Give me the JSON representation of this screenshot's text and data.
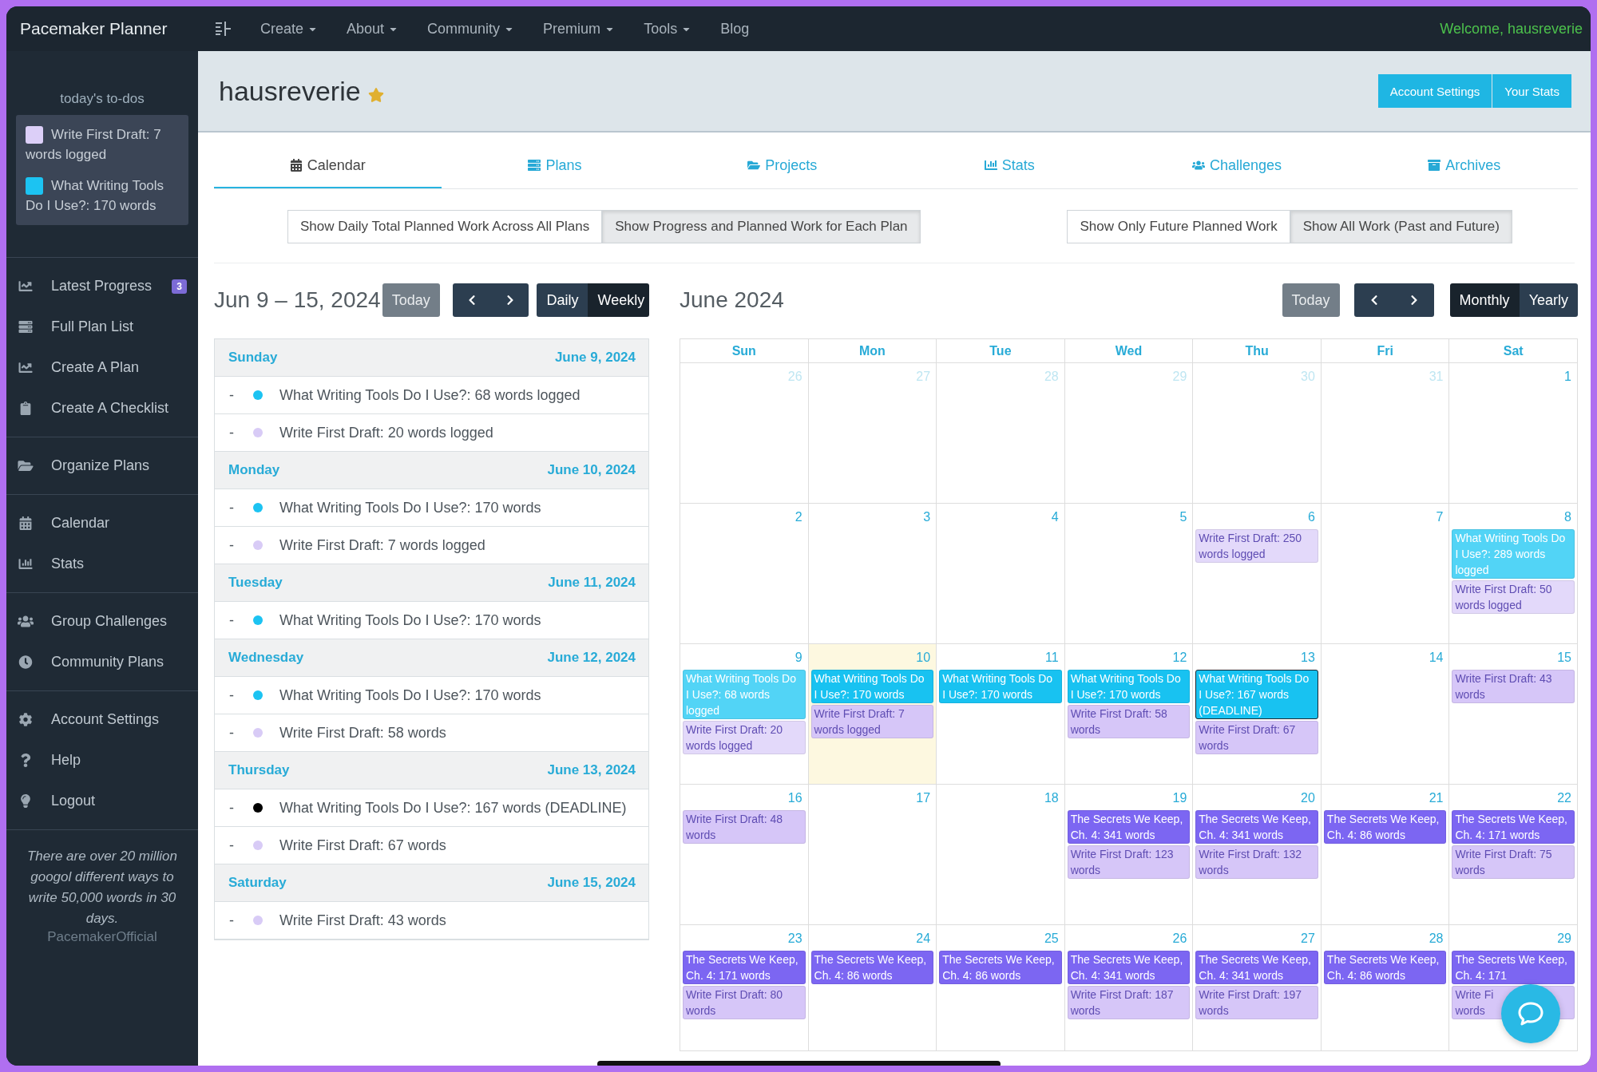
{
  "nav": {
    "brand": "Pacemaker Planner",
    "menus": [
      {
        "label": "Create",
        "dropdown": true
      },
      {
        "label": "About",
        "dropdown": true
      },
      {
        "label": "Community",
        "dropdown": true
      },
      {
        "label": "Premium",
        "dropdown": true
      },
      {
        "label": "Tools",
        "dropdown": true
      },
      {
        "label": "Blog",
        "dropdown": false
      }
    ],
    "welcome": "Welcome, hausreverie"
  },
  "sidebar": {
    "todo_title": "today's to-dos",
    "todos": [
      {
        "text": "Write First Draft: 7 words logged",
        "color": "#dccff8"
      },
      {
        "text": "What Writing Tools Do I Use?: 170 words",
        "color": "#1cc3f2"
      }
    ],
    "groups": [
      [
        {
          "label": "Latest Progress",
          "badge": "3"
        },
        {
          "label": "Full Plan List"
        },
        {
          "label": "Create A Plan"
        },
        {
          "label": "Create A Checklist"
        }
      ],
      [
        {
          "label": "Organize Plans"
        }
      ],
      [
        {
          "label": "Calendar"
        },
        {
          "label": "Stats"
        }
      ],
      [
        {
          "label": "Group Challenges"
        },
        {
          "label": "Community Plans"
        }
      ],
      [
        {
          "label": "Account Settings"
        },
        {
          "label": "Help"
        },
        {
          "label": "Logout"
        }
      ]
    ],
    "quote": "There are over 20 million googol different ways to write 50,000 words in 30 days.",
    "quote_author": "PacemakerOfficial"
  },
  "header": {
    "username": "hausreverie",
    "starred": true,
    "buttons": [
      "Account Settings",
      "Your Stats"
    ]
  },
  "tabs": [
    {
      "label": "Calendar",
      "selected": true
    },
    {
      "label": "Plans",
      "selected": false
    },
    {
      "label": "Projects",
      "selected": false
    },
    {
      "label": "Stats",
      "selected": false
    },
    {
      "label": "Challenges",
      "selected": false
    },
    {
      "label": "Archives",
      "selected": false
    }
  ],
  "toggles": {
    "left": [
      {
        "label": "Show Daily Total Planned Work Across All Plans",
        "selected": false
      },
      {
        "label": "Show Progress and Planned Work for Each Plan",
        "selected": true
      }
    ],
    "right": [
      {
        "label": "Show Only Future Planned Work",
        "selected": false
      },
      {
        "label": "Show All Work (Past and Future)",
        "selected": true
      }
    ]
  },
  "week": {
    "title": "Jun 9 – 15, 2024",
    "today": "Today",
    "views": [
      {
        "label": "Daily",
        "selected": false
      },
      {
        "label": "Weekly",
        "selected": true
      }
    ],
    "days": [
      {
        "day": "Sunday",
        "date": "June 9, 2024",
        "entries": [
          {
            "dash": "-",
            "text": "What Writing Tools Do I Use?: 68 words logged",
            "color": "#1cc3f2"
          },
          {
            "dash": "-",
            "text": "Write First Draft: 20 words logged",
            "color": "#d8cbf6"
          }
        ]
      },
      {
        "day": "Monday",
        "date": "June 10, 2024",
        "entries": [
          {
            "dash": "-",
            "text": "What Writing Tools Do I Use?: 170 words",
            "color": "#1cc3f2"
          },
          {
            "dash": "-",
            "text": "Write First Draft: 7 words logged",
            "color": "#d8cbf6"
          }
        ]
      },
      {
        "day": "Tuesday",
        "date": "June 11, 2024",
        "entries": [
          {
            "dash": "-",
            "text": "What Writing Tools Do I Use?: 170 words",
            "color": "#1cc3f2"
          }
        ]
      },
      {
        "day": "Wednesday",
        "date": "June 12, 2024",
        "entries": [
          {
            "dash": "-",
            "text": "What Writing Tools Do I Use?: 170 words",
            "color": "#1cc3f2"
          },
          {
            "dash": "-",
            "text": "Write First Draft: 58 words",
            "color": "#d8cbf6"
          }
        ]
      },
      {
        "day": "Thursday",
        "date": "June 13, 2024",
        "entries": [
          {
            "dash": "-",
            "text": "What Writing Tools Do I Use?: 167 words (DEADLINE)",
            "color": "#000000"
          },
          {
            "dash": "-",
            "text": "Write First Draft: 67 words",
            "color": "#d8cbf6"
          }
        ]
      },
      {
        "day": "Saturday",
        "date": "June 15, 2024",
        "entries": [
          {
            "dash": "-",
            "text": "Write First Draft: 43 words",
            "color": "#d8cbf6"
          }
        ]
      }
    ]
  },
  "month": {
    "title": "June 2024",
    "today": "Today",
    "views": [
      {
        "label": "Monthly",
        "selected": true
      },
      {
        "label": "Yearly",
        "selected": false
      }
    ],
    "weekdays": [
      "Sun",
      "Mon",
      "Tue",
      "Wed",
      "Thu",
      "Fri",
      "Sat"
    ],
    "weeks": [
      [
        {
          "n": "26",
          "outside": true,
          "today": false
        },
        {
          "n": "27",
          "outside": true,
          "today": false
        },
        {
          "n": "28",
          "outside": true,
          "today": false
        },
        {
          "n": "29",
          "outside": true,
          "today": false
        },
        {
          "n": "30",
          "outside": true,
          "today": false
        },
        {
          "n": "31",
          "outside": true,
          "today": false
        },
        {
          "n": "1",
          "outside": false,
          "today": false
        }
      ],
      [
        {
          "n": "2",
          "outside": false,
          "today": false
        },
        {
          "n": "3",
          "outside": false,
          "today": false
        },
        {
          "n": "4",
          "outside": false,
          "today": false
        },
        {
          "n": "5",
          "outside": false,
          "today": false
        },
        {
          "n": "6",
          "outside": false,
          "today": false,
          "events": [
            {
              "text": "Write First Draft: 250 words logged",
              "color": "#e3d9fa",
              "deadline": false
            }
          ]
        },
        {
          "n": "7",
          "outside": false,
          "today": false
        },
        {
          "n": "8",
          "outside": false,
          "today": false,
          "events": [
            {
              "text": "What Writing Tools Do I Use?: 289 words logged",
              "color": "#52d4f6",
              "deadline": false
            },
            {
              "text": "Write First Draft: 50 words logged",
              "color": "#e3d9fa",
              "deadline": false
            }
          ]
        }
      ],
      [
        {
          "n": "9",
          "outside": false,
          "today": false,
          "events": [
            {
              "text": "What Writing Tools Do I Use?: 68 words logged",
              "color": "#52d4f6",
              "deadline": false
            },
            {
              "text": "Write First Draft: 20 words logged",
              "color": "#e3d9fa",
              "deadline": false
            }
          ]
        },
        {
          "n": "10",
          "outside": false,
          "today": true,
          "events": [
            {
              "text": "What Writing Tools Do I Use?: 170 words",
              "color": "#18c2f1",
              "deadline": false
            },
            {
              "text": "Write First Draft: 7 words logged",
              "color": "#d6c6f8",
              "deadline": false
            }
          ]
        },
        {
          "n": "11",
          "outside": false,
          "today": false,
          "events": [
            {
              "text": "What Writing Tools Do I Use?: 170 words",
              "color": "#18c2f1",
              "deadline": false
            }
          ]
        },
        {
          "n": "12",
          "outside": false,
          "today": false,
          "events": [
            {
              "text": "What Writing Tools Do I Use?: 170 words",
              "color": "#18c2f1",
              "deadline": false
            },
            {
              "text": "Write First Draft: 58 words",
              "color": "#d6c6f8",
              "deadline": false
            }
          ]
        },
        {
          "n": "13",
          "outside": false,
          "today": false,
          "events": [
            {
              "text": "What Writing Tools Do I Use?: 167 words (DEADLINE)",
              "color": "#18c2f1",
              "deadline": true
            },
            {
              "text": "Write First Draft: 67 words",
              "color": "#d6c6f8",
              "deadline": false
            }
          ]
        },
        {
          "n": "14",
          "outside": false,
          "today": false
        },
        {
          "n": "15",
          "outside": false,
          "today": false,
          "events": [
            {
              "text": "Write First Draft: 43 words",
              "color": "#d6c6f8",
              "deadline": false
            }
          ]
        }
      ],
      [
        {
          "n": "16",
          "outside": false,
          "today": false,
          "events": [
            {
              "text": "Write First Draft: 48 words",
              "color": "#d6c6f8",
              "deadline": false
            }
          ]
        },
        {
          "n": "17",
          "outside": false,
          "today": false
        },
        {
          "n": "18",
          "outside": false,
          "today": false
        },
        {
          "n": "19",
          "outside": false,
          "today": false,
          "events": [
            {
              "text": "The Secrets We Keep, Ch. 4: 341 words",
              "color": "#7c66f2",
              "deadline": false
            },
            {
              "text": "Write First Draft: 123 words",
              "color": "#d6c6f8",
              "deadline": false
            }
          ]
        },
        {
          "n": "20",
          "outside": false,
          "today": false,
          "events": [
            {
              "text": "The Secrets We Keep, Ch. 4: 341 words",
              "color": "#7c66f2",
              "deadline": false
            },
            {
              "text": "Write First Draft: 132 words",
              "color": "#d6c6f8",
              "deadline": false
            }
          ]
        },
        {
          "n": "21",
          "outside": false,
          "today": false,
          "events": [
            {
              "text": "The Secrets We Keep, Ch. 4: 86 words",
              "color": "#7c66f2",
              "deadline": false
            }
          ]
        },
        {
          "n": "22",
          "outside": false,
          "today": false,
          "events": [
            {
              "text": "The Secrets We Keep, Ch. 4: 171 words",
              "color": "#7c66f2",
              "deadline": false
            },
            {
              "text": "Write First Draft: 75 words",
              "color": "#d6c6f8",
              "deadline": false
            }
          ]
        }
      ],
      [
        {
          "n": "23",
          "outside": false,
          "today": false,
          "events": [
            {
              "text": "The Secrets We Keep, Ch. 4: 171 words",
              "color": "#7c66f2",
              "deadline": false
            },
            {
              "text": "Write First Draft: 80 words",
              "color": "#d6c6f8",
              "deadline": false
            }
          ]
        },
        {
          "n": "24",
          "outside": false,
          "today": false,
          "events": [
            {
              "text": "The Secrets We Keep, Ch. 4: 86 words",
              "color": "#7c66f2",
              "deadline": false
            }
          ]
        },
        {
          "n": "25",
          "outside": false,
          "today": false,
          "events": [
            {
              "text": "The Secrets We Keep, Ch. 4: 86 words",
              "color": "#7c66f2",
              "deadline": false
            }
          ]
        },
        {
          "n": "26",
          "outside": false,
          "today": false,
          "events": [
            {
              "text": "The Secrets We Keep, Ch. 4: 341 words",
              "color": "#7c66f2",
              "deadline": false
            },
            {
              "text": "Write First Draft: 187 words",
              "color": "#d6c6f8",
              "deadline": false
            }
          ]
        },
        {
          "n": "27",
          "outside": false,
          "today": false,
          "events": [
            {
              "text": "The Secrets We Keep, Ch. 4: 341 words",
              "color": "#7c66f2",
              "deadline": false
            },
            {
              "text": "Write First Draft: 197 words",
              "color": "#d6c6f8",
              "deadline": false
            }
          ]
        },
        {
          "n": "28",
          "outside": false,
          "today": false,
          "events": [
            {
              "text": "The Secrets We Keep, Ch. 4: 86 words",
              "color": "#7c66f2",
              "deadline": false
            }
          ]
        },
        {
          "n": "29",
          "outside": false,
          "today": false,
          "events": [
            {
              "text": "The Secrets We Keep, Ch. 4: 171",
              "color": "#7c66f2",
              "deadline": false
            },
            {
              "text": "Write Fi\nwords",
              "color": "#d6c6f8",
              "deadline": false
            }
          ]
        }
      ]
    ]
  }
}
